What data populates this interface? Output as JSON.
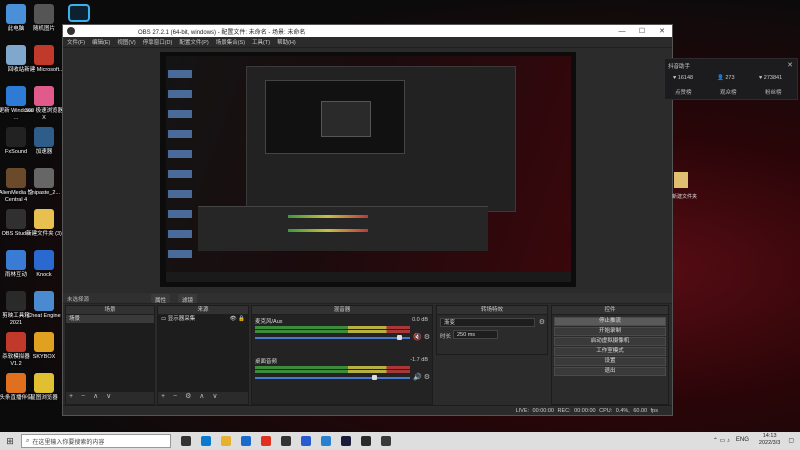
{
  "desktop": {
    "icons": [
      {
        "label": "此电脑",
        "color": "#4a90d9"
      },
      {
        "label": "随机图片",
        "color": "#555"
      },
      {
        "label": "回收站",
        "color": "#7fa8cc"
      },
      {
        "label": "新建 Microsoft...",
        "color": "#c0392b"
      },
      {
        "label": "更新 Windows ...",
        "color": "#2e7bd6"
      },
      {
        "label": "360 极速浏览器X",
        "color": "#e05a8c"
      },
      {
        "label": "FxSound",
        "color": "#222"
      },
      {
        "label": "加速器",
        "color": "#2f5d8a"
      },
      {
        "label": "AlienMedia 性Central 4",
        "color": "#6a4a2a"
      },
      {
        "label": "Snipaste_2...",
        "color": "#666"
      },
      {
        "label": "OBS Studio",
        "color": "#303030"
      },
      {
        "label": "新建文件夹 (3)",
        "color": "#e8c050"
      },
      {
        "label": "雨林互动",
        "color": "#3a7bd5"
      },
      {
        "label": "Knock",
        "color": "#2a6ad0"
      },
      {
        "label": "剪映工具箱 2021",
        "color": "#2a2a2a"
      },
      {
        "label": "Cheat Engine",
        "color": "#4a8ad0"
      },
      {
        "label": "杀软模拟器 V1.2",
        "color": "#c0392b"
      },
      {
        "label": "SKYBOX",
        "color": "#e0a020"
      },
      {
        "label": "头条直播伴侣",
        "color": "#e07020"
      },
      {
        "label": "星图浏览器",
        "color": "#e0c030"
      }
    ]
  },
  "window": {
    "title": "OBS 27.2.1 (64-bit, windows) - 配置文件: 未命名 - 场景: 未命名",
    "minimize": "—",
    "maximize": "☐",
    "close": "✕",
    "menu": [
      "文件(F)",
      "编辑(E)",
      "视图(V)",
      "停靠窗口(D)",
      "配置文件(P)",
      "场景集合(S)",
      "工具(T)",
      "帮助(H)"
    ]
  },
  "docks": {
    "no_source": "未选择源",
    "properties_btn": "属性",
    "filters_btn": "滤镜"
  },
  "scenes": {
    "title": "场景",
    "items": [
      "场景"
    ],
    "footer": "+ − ∧ ∨"
  },
  "sources": {
    "title": "来源",
    "items": [
      "显示器采集"
    ],
    "footer": "+ − ⚙ ∧ ∨"
  },
  "mixer": {
    "title": "混音器",
    "tracks": [
      {
        "name": "麦克风/Aux",
        "db": "0.0 dB",
        "muted": true
      },
      {
        "name": "桌面音频",
        "db": "-1.7 dB",
        "muted": false
      }
    ]
  },
  "transitions": {
    "title": "转场特效",
    "type": "渐变",
    "duration_label": "时长",
    "duration": "250 ms"
  },
  "controls": {
    "title": "控件",
    "buttons": [
      "停止推流",
      "开始录制",
      "启动虚拟摄像机",
      "工作室模式",
      "设置",
      "退出"
    ],
    "active_index": 0
  },
  "status": "LIVE: 00:00:00   REC: 00:00:00   CPU: 0.4%, 60.00 fps",
  "widget": {
    "title": "抖音助手",
    "close": "✕",
    "stats": [
      "♥ 16148",
      "👤 273",
      "♥ 273841"
    ],
    "tabs": [
      "点赞榜",
      "观众榜",
      "粉丝榜"
    ]
  },
  "right_desktop_label": "新建文件夹",
  "taskbar": {
    "search_placeholder": "在这里输入你要搜索的内容",
    "lang": "ENG",
    "time": "14:13",
    "date": "2022/3/3"
  }
}
